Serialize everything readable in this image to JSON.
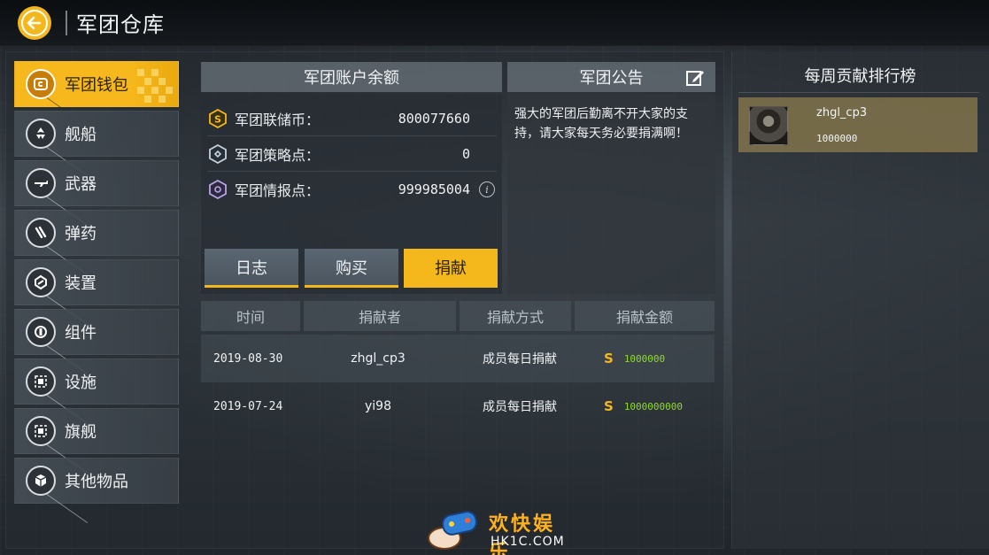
{
  "header": {
    "title": "军团仓库"
  },
  "sidebar": {
    "items": [
      {
        "label": "军团钱包",
        "icon": "wallet-icon",
        "active": true
      },
      {
        "label": "舰船",
        "icon": "ship-icon"
      },
      {
        "label": "武器",
        "icon": "weapon-icon"
      },
      {
        "label": "弹药",
        "icon": "ammo-icon"
      },
      {
        "label": "装置",
        "icon": "device-icon"
      },
      {
        "label": "组件",
        "icon": "component-icon"
      },
      {
        "label": "设施",
        "icon": "facility-icon"
      },
      {
        "label": "旗舰",
        "icon": "flagship-icon"
      },
      {
        "label": "其他物品",
        "icon": "misc-items-icon"
      }
    ]
  },
  "balance": {
    "title": "军团账户余额",
    "rows": [
      {
        "label": "军团联储币：",
        "value": "800077660",
        "icon": "reserve-coin-icon"
      },
      {
        "label": "军团策略点：",
        "value": "0",
        "icon": "strategy-point-icon"
      },
      {
        "label": "军团情报点：",
        "value": "999985004",
        "icon": "intel-point-icon"
      }
    ],
    "buttons": {
      "log": "日志",
      "buy": "购买",
      "donate": "捐献"
    }
  },
  "notice": {
    "title": "军团公告",
    "text_line1": "强大的军团后勤离不开大家的支",
    "text_line2": "持，请大家每天务必要捐满啊！"
  },
  "table": {
    "headers": [
      "时间",
      "捐献者",
      "捐献方式",
      "捐献金额"
    ],
    "rows": [
      {
        "date": "2019-08-30",
        "donor": "zhgl_cp3",
        "method": "成员每日捐献",
        "amount": "1000000"
      },
      {
        "date": "2019-07-24",
        "donor": "yi98",
        "method": "成员每日捐献",
        "amount": "1000000000"
      }
    ]
  },
  "ranking": {
    "title": "每周贡献排行榜",
    "entries": [
      {
        "name": "zhgl_cp3",
        "amount": "1000000"
      }
    ]
  },
  "watermark": {
    "cn": "欢快娱乐",
    "en": "HK1C.COM"
  },
  "colors": {
    "accent": "#f5b81c",
    "amount_green": "#8fdc2a"
  }
}
